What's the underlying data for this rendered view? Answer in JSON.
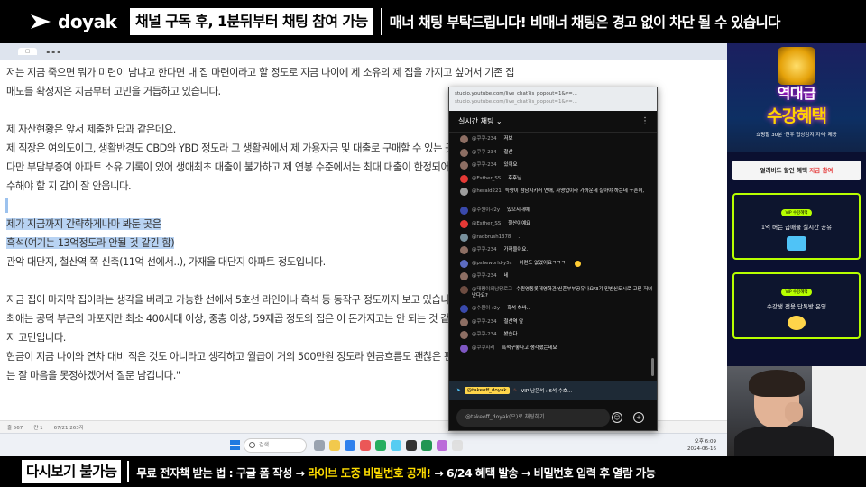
{
  "top_banner": {
    "logo": "doyak",
    "notice_box": "채널 구독 후, 1분뒤부터 채팅 참여 가능",
    "notice_right": "매너 채팅 부탁드립니다! 비매너 채팅은 경고 없이 차단 될 수 있습니다"
  },
  "document": {
    "lines": [
      "저는 지금 죽으면 뭐가 미련이 남냐고 한다면 내 집 마련이라고 할 정도로 지금 나이에 제 소유의 제 집을 가지고 싶어서 기존 집",
      "매도를 확정지은 지금부터 고민을 거듭하고 있습니다.",
      "제 자산현황은 앞서 제출한 답과 같은데요.",
      "제 직장은 여의도이고, 생활반경도 CBD와 YBD 정도라 그 생활권에서 제 가용자금 및 대출로 구매할 수 있는 곳을 찾아봤습니다.",
      "다만 부담부증여 아파트 소유 기록이 있어 생애최초 대출이 불가하고 제 연봉 수준에서는 최대 대출이 한정되어 있어서 어느 곳을 매",
      "수해야 할 지 감이 잘 안옵니다.",
      "제가 지금까지 간략하게나마 봐둔 곳은",
      "흑석(여기는 13억정도라 안될 것 같긴 함)",
      "관악 대단지, 철산역 쪽 신축(11억 선에서..), 가재울 대단지 아파트 정도입니다.",
      "지금 집이 마지막 집이라는 생각을 버리고 가능한 선에서 5호선 라인이나 흑석 등 동작구 정도까지 보고 있습니다.",
      "최애는 공덕 부근의 마포지만 최소 400세대 이상, 중층 이상, 59제곱 정도의 집은 이 돈가지고는 안 되는 것 같아 어디에 집중해야 할",
      "지 고민입니다.",
      "현금이 지금 나이와 연차 대비 적은 것도 아니라고 생각하고 월급이 거의 500만원 정도라 현금흐름도 괜찮은 편이라 생각의 범위에서",
      "는 잘 마음을 못정하겠어서 질문 남깁니다.\""
    ]
  },
  "chat": {
    "url": "studio.youtube.com/live_chat?is_popout=1&v=...",
    "title": "실시간 채팅",
    "messages": [
      {
        "author": "@쿠쿠-234",
        "text": "저보"
      },
      {
        "author": "@쿠쿠-234",
        "text": "철산"
      },
      {
        "author": "@쿠쿠-234",
        "text": "있어요"
      },
      {
        "author": "@Esther_SS",
        "text": "후후님"
      },
      {
        "author": "@herald221",
        "text": "득량이 첨담시키러 연애, 자영업이라 가까운데 살아야 하는데 ㅜ흔이,"
      },
      {
        "author": "@수원이-r2y",
        "text": "있으시대예"
      },
      {
        "author": "@Esther_SS",
        "text": "철산이예요"
      },
      {
        "author": "@radbrush1378",
        "text": "."
      },
      {
        "author": "@쿠쿠-234",
        "text": "가재울이요."
      },
      {
        "author": "@psheworld-y5s",
        "text": "이런도 없었어요ㅋㅋㅋ"
      },
      {
        "author": "@쿠쿠-234",
        "text": "네"
      },
      {
        "author": "@태평이의남당로그",
        "text": "수원영통롯데영화관/신혼부부공유나요/3기 민반신도시로 고민 저녀난다요?"
      },
      {
        "author": "@수원이-r2y",
        "text": "흑석 하바.."
      },
      {
        "author": "@쿠쿠-234",
        "text": "철산역 앞"
      },
      {
        "author": "@쿠쿠-234",
        "text": "봤습다"
      },
      {
        "author": "@쿠쿠시리",
        "text": "흑석구좋다고 생각했는데요"
      }
    ],
    "pinned": {
      "author": "@takeoff_doyak",
      "text": "VIP 남은석 : 6석 수호..."
    },
    "input_placeholder": "@takeoff_doyak(으)로 채팅하기"
  },
  "side_ad": {
    "title1": "역대급",
    "title2": "수강혜택",
    "subtitle": "쇼핑할 30분 '연우 협상감지 지식' 제공",
    "early_bird": "얼리버드 할인 혜택",
    "early_bird_highlight": "지금 참여",
    "vip_label": "VIP 수강혜택",
    "vip_card1": "1억 버는 급매물 실시간 공유",
    "vip_card2": "수강생 전용 단톡방 운영"
  },
  "taskbar": {
    "search": "검색",
    "time": "오후 6:09",
    "date": "2024-06-16"
  },
  "status_bar": [
    "줄 567",
    "칸 1",
    "67/21,263자"
  ],
  "bottom_banner": {
    "box": "다시보기 불가능",
    "text_before": "무료 전자책 받는 법 : 구글 폼 작성 → ",
    "text_highlight": "라이브 도중 비밀번호 공개!",
    "text_after": " → 6/24 혜택 발송 → 비밀번호 입력 후 열람 가능"
  },
  "colors": {
    "highlight": "#b8d3f3",
    "vip_border": "#b7ff00",
    "banner_yellow": "#ffdd00"
  }
}
